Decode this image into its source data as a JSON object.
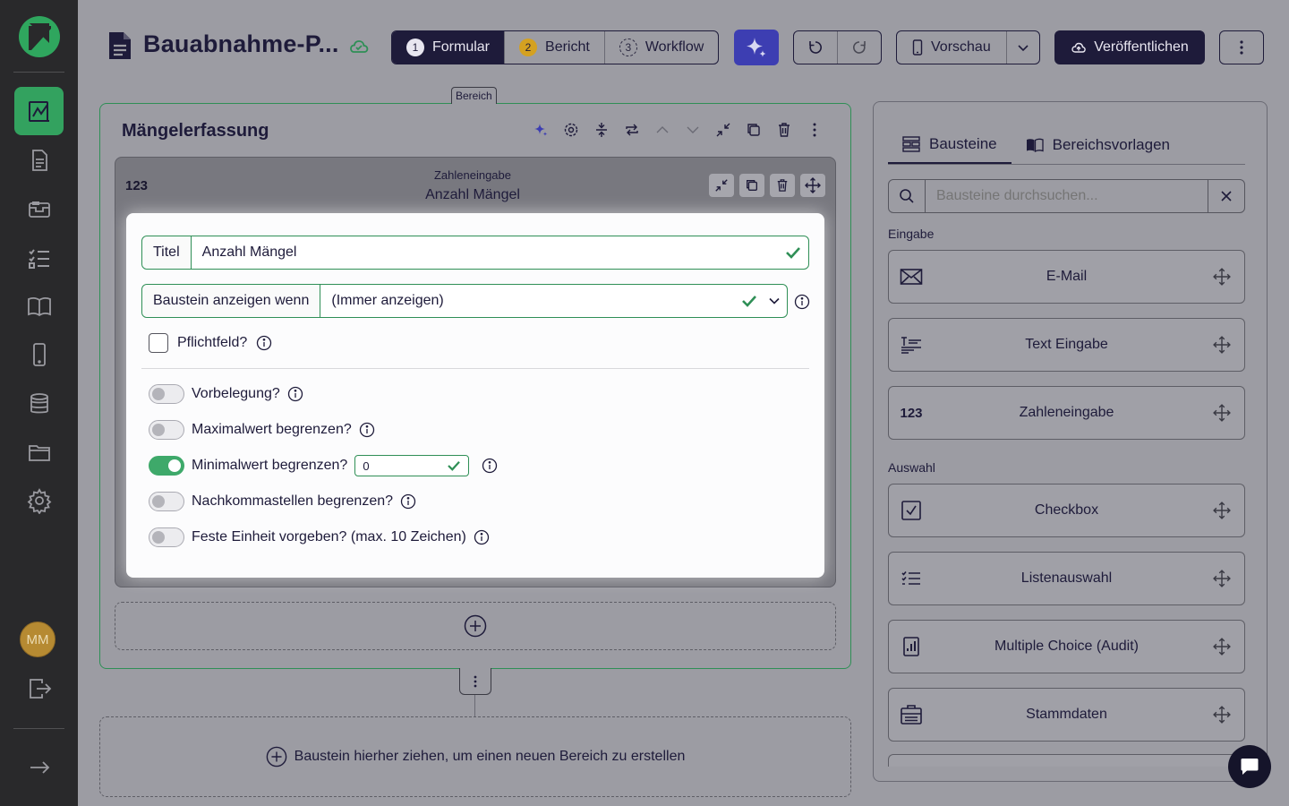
{
  "sidebar": {
    "user_initials": "MM",
    "items": [
      {
        "name": "form-editor",
        "icon": "form-edit-icon",
        "active": true
      },
      {
        "name": "reports",
        "icon": "report-icon"
      },
      {
        "name": "inbox",
        "icon": "inbox-icon"
      },
      {
        "name": "checklists",
        "icon": "checklist-icon"
      },
      {
        "name": "docs",
        "icon": "book-icon"
      },
      {
        "name": "mobile",
        "icon": "mobile-icon"
      },
      {
        "name": "database",
        "icon": "database-icon"
      },
      {
        "name": "files",
        "icon": "folder-icon"
      },
      {
        "name": "settings",
        "icon": "gear-icon"
      }
    ]
  },
  "header": {
    "title": "Bauabnahme-P...",
    "steps": [
      {
        "num": "1",
        "label": "Formular"
      },
      {
        "num": "2",
        "label": "Bericht"
      },
      {
        "num": "3",
        "label": "Workflow"
      }
    ],
    "preview_label": "Vorschau",
    "publish_label": "Veröffentlichen"
  },
  "section": {
    "tag": "Bereich",
    "title": "Mängelerfassung"
  },
  "block": {
    "num_badge": "123",
    "type": "Zahleneingabe",
    "name": "Anzahl Mängel",
    "title_label": "Titel",
    "title_value": "Anzahl Mängel",
    "condition_label": "Baustein anzeigen wenn",
    "condition_value": "(Immer anzeigen)",
    "required_label": "Pflichtfeld?",
    "toggles": [
      {
        "label": "Vorbelegung?",
        "on": false
      },
      {
        "label": "Maximalwert begrenzen?",
        "on": false
      },
      {
        "label": "Minimalwert begrenzen?",
        "on": true,
        "value": "0"
      },
      {
        "label": "Nachkommastellen begrenzen?",
        "on": false
      },
      {
        "label": "Feste Einheit vorgeben? (max. 10 Zeichen)",
        "on": false
      }
    ]
  },
  "drop_zone_label": "Baustein hierher ziehen, um einen neuen Bereich zu erstellen",
  "panel": {
    "tabs": [
      "Bausteine",
      "Bereichsvorlagen"
    ],
    "search_placeholder": "Bausteine durchsuchen...",
    "groups": [
      {
        "label": "Eingabe",
        "items": [
          {
            "label": "E-Mail",
            "icon": "envelope-icon"
          },
          {
            "label": "Text Eingabe",
            "icon": "text-lines-icon"
          },
          {
            "label": "Zahleneingabe",
            "icon": "number-icon",
            "icon_text": "123"
          }
        ]
      },
      {
        "label": "Auswahl",
        "items": [
          {
            "label": "Checkbox",
            "icon": "checkbox-icon"
          },
          {
            "label": "Listenauswahl",
            "icon": "list-icon"
          },
          {
            "label": "Multiple Choice (Audit)",
            "icon": "audit-chart-icon"
          },
          {
            "label": "Stammdaten",
            "icon": "master-data-icon"
          }
        ]
      }
    ]
  },
  "colors": {
    "brand_green": "#33a25f",
    "dark_navy": "#1e1b3a",
    "ai_blue": "#3d3eb2",
    "step_yellow": "#d4a121",
    "sidebar_bg": "#29292b"
  }
}
